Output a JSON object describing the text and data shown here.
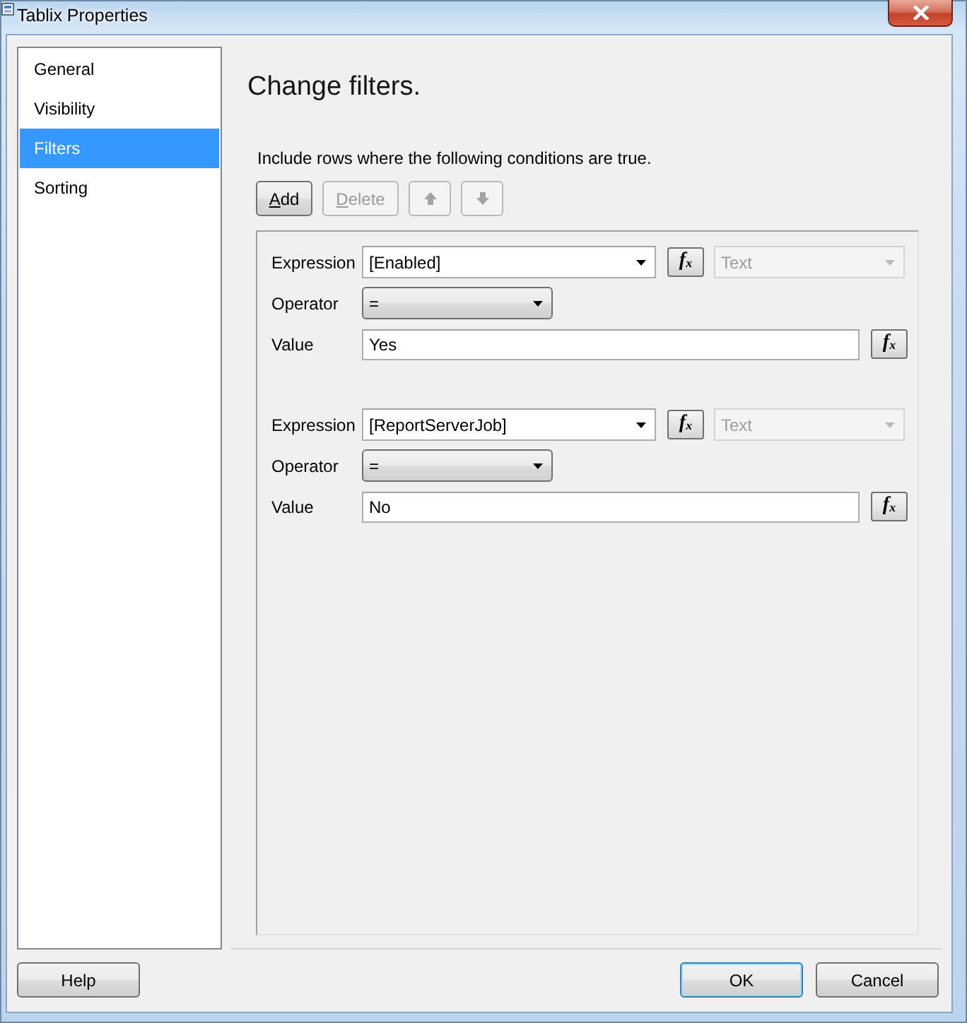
{
  "window": {
    "title": "Tablix Properties"
  },
  "sidebar": {
    "items": [
      {
        "label": "General",
        "selected": false
      },
      {
        "label": "Visibility",
        "selected": false
      },
      {
        "label": "Filters",
        "selected": true
      },
      {
        "label": "Sorting",
        "selected": false
      }
    ]
  },
  "page": {
    "heading": "Change filters.",
    "instruction": "Include rows where the following conditions are true."
  },
  "toolbar": [
    {
      "kind": "text",
      "label": "Add",
      "access_key_underlined": true,
      "disabled": false
    },
    {
      "kind": "text",
      "label": "Delete",
      "access_key_underlined": true,
      "disabled": true
    },
    {
      "kind": "up",
      "disabled": true
    },
    {
      "kind": "down",
      "disabled": true
    }
  ],
  "filters": [
    {
      "expression_label": "Expression",
      "expression": "[Enabled]",
      "expression_button": "f$_{x}$",
      "type": {
        "value": "Text",
        "disabled": true
      },
      "operator_label": "Operator",
      "operator": "=",
      "value_label": "Value",
      "value": "Yes",
      "value_button": "f$_{x}$"
    },
    {
      "expression_label": "Expression",
      "expression": "[ReportServerJob]",
      "expression_button": "f$_{x}$",
      "type": {
        "value": "Text",
        "disabled": true
      },
      "operator_label": "Operator",
      "operator": "=",
      "value_label": "Value",
      "value": "No",
      "value_button": "f$_{x}$"
    }
  ],
  "footer": {
    "buttons": [
      {
        "label": "Help",
        "default": false
      },
      {
        "label": "OK",
        "default": true
      },
      {
        "label": "Cancel",
        "default": false
      }
    ]
  }
}
